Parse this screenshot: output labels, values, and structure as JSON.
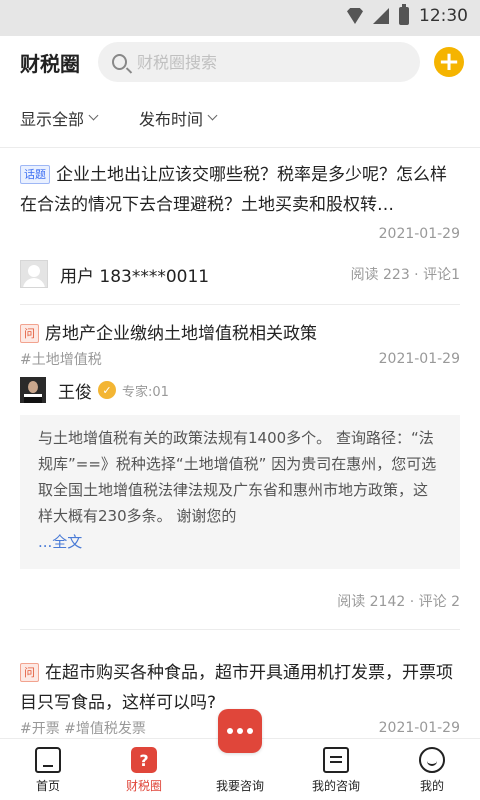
{
  "status_bar": {
    "time": "12:30"
  },
  "header": {
    "title": "财税圈",
    "search_placeholder": "财税圈搜索"
  },
  "filters": [
    {
      "label": "显示全部"
    },
    {
      "label": "发布时间"
    }
  ],
  "posts": [
    {
      "tag": "话题",
      "title": "企业土地出让应该交哪些税？税率是多少呢？怎么样在合法的情况下去合理避税？土地买卖和股权转…",
      "date": "2021-01-29",
      "user": "用户 183****0011",
      "stats": "阅读 223 · 评论1"
    },
    {
      "tag": "问",
      "title": "房地产企业缴纳土地增值税相关政策",
      "hashtag": "#土地增值税",
      "date": "2021-01-29",
      "expert_name": "王俊",
      "expert_label": "专家:01",
      "answer": "与土地增值税有关的政策法规有1400多个。 查询路径：“法规库”==》税种选择“土地增值税” 因为贵司在惠州，您可选取全国土地增值税法律法规及广东省和惠州市地方政策，这样大概有230多条。 谢谢您的",
      "more": "...全文",
      "stats": "阅读 2142 · 评论 2"
    },
    {
      "tag": "问",
      "title": "在超市购买各种食品，超市开具通用机打发票，开票项目只写食品，这样可以吗?",
      "hashtags": "#开票   #增值税发票",
      "date": "2021-01-29"
    }
  ],
  "bottom_nav": [
    {
      "label": "首页"
    },
    {
      "label": "财税圈"
    },
    {
      "label": "我要咨询"
    },
    {
      "label": "我的咨询"
    },
    {
      "label": "我的"
    }
  ],
  "colors": {
    "accent": "#e0463a",
    "add_button": "#f5b400",
    "link": "#4a7bd6"
  }
}
